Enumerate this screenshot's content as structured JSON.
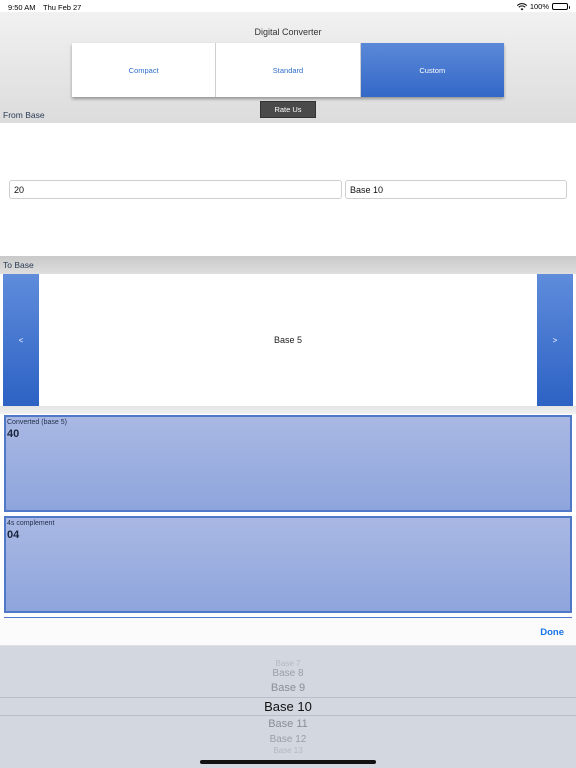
{
  "status_bar": {
    "time": "9:50 AM",
    "date": "Thu Feb 27",
    "battery": "100%"
  },
  "app": {
    "title": "Digital Converter"
  },
  "segments": [
    {
      "label": "Compact",
      "selected": false
    },
    {
      "label": "Standard",
      "selected": false
    },
    {
      "label": "Custom",
      "selected": true
    }
  ],
  "rate_button": "Rate Us",
  "from_base": {
    "label": "From Base",
    "number_value": "20",
    "base_value": "Base 10"
  },
  "to_base": {
    "label": "To Base",
    "prev": "<",
    "next": ">",
    "value": "Base 5"
  },
  "results": [
    {
      "label": "Converted (base 5)",
      "value": "40"
    },
    {
      "label": "4s complement",
      "value": "04"
    }
  ],
  "picker": {
    "done": "Done",
    "items": [
      "Base 7",
      "Base 8",
      "Base 9",
      "Base 10",
      "Base 11",
      "Base 12",
      "Base 13"
    ],
    "selected": "Base 10"
  },
  "colors": {
    "accent_blue": "#3468c8",
    "done_blue": "#1a73e8",
    "result_fill": "#96abde"
  }
}
